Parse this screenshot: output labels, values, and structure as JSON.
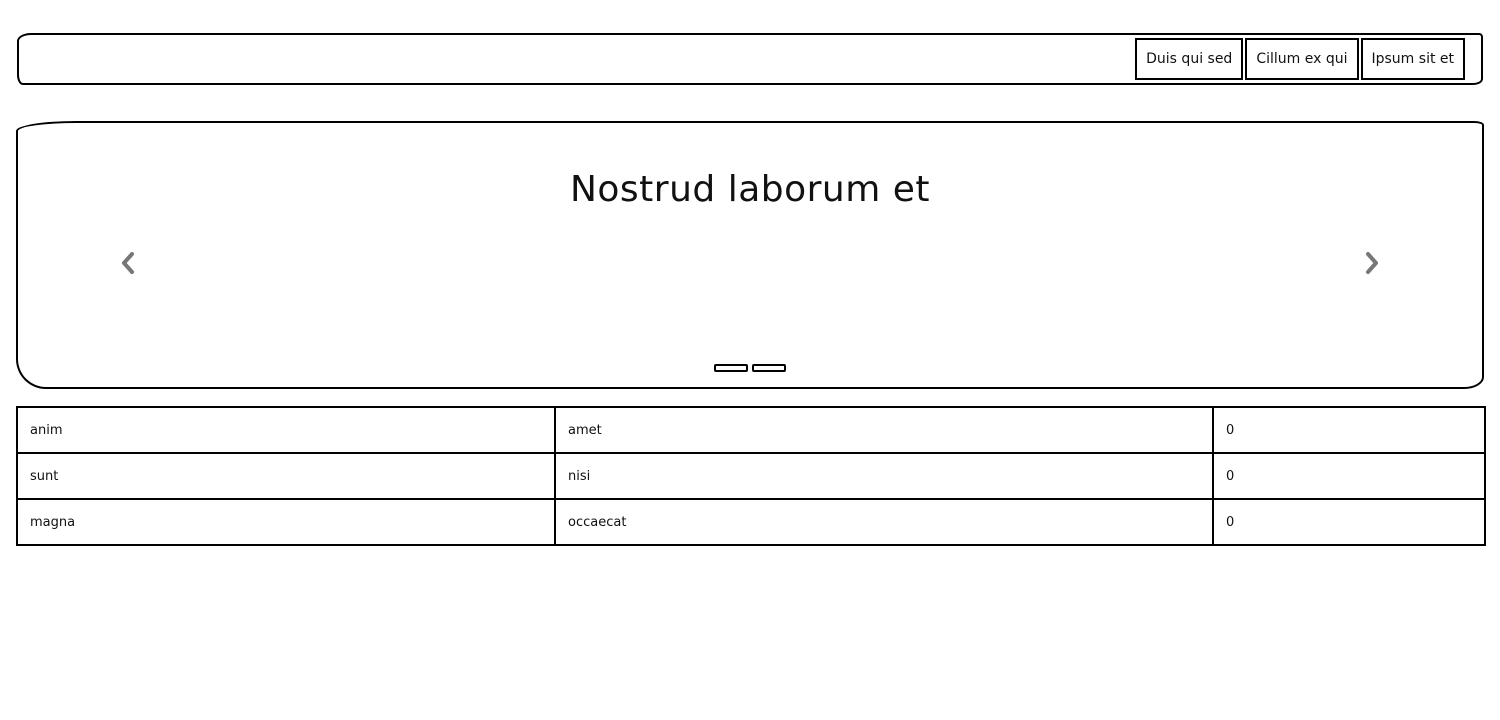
{
  "navbar": {
    "buttons": [
      {
        "label": "Duis qui sed"
      },
      {
        "label": "Cillum ex qui"
      },
      {
        "label": "Ipsum sit et"
      }
    ]
  },
  "carousel": {
    "title": "Nostrud laborum et",
    "prev_icon": "chevron-left-icon",
    "next_icon": "chevron-right-icon",
    "slide_count": 2
  },
  "table": {
    "rows": [
      [
        "anim",
        "amet",
        "0"
      ],
      [
        "sunt",
        "nisi",
        "0"
      ],
      [
        "magna",
        "occaecat",
        "0"
      ]
    ]
  },
  "colors": {
    "border": "#000000",
    "background": "#ffffff",
    "arrow": "#777777"
  }
}
